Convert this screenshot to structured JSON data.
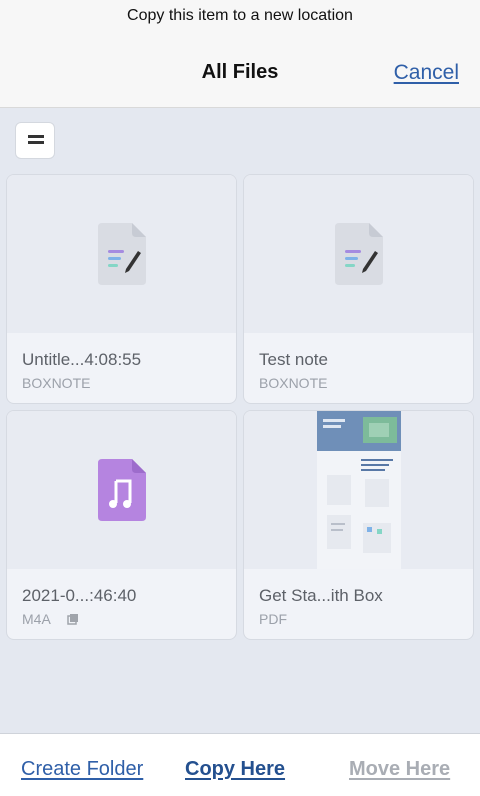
{
  "header": {
    "prompt": "Copy this item to a new location",
    "title": "All Files",
    "cancel_label": "Cancel"
  },
  "toolbar": {
    "view_toggle_icon": "list-view-icon"
  },
  "files": [
    {
      "name": "Untitle...4:08:55",
      "type": "BOXNOTE",
      "icon": "boxnote-icon"
    },
    {
      "name": "Test note",
      "type": "BOXNOTE",
      "icon": "boxnote-icon"
    },
    {
      "name": "2021-0...:46:40",
      "type": "M4A",
      "icon": "audio-file-icon",
      "badge": "offline-icon"
    },
    {
      "name": "Get Sta...ith Box",
      "type": "PDF",
      "icon": "pdf-thumbnail"
    }
  ],
  "footer": {
    "create_folder_label": "Create Folder",
    "copy_here_label": "Copy Here",
    "move_here_label": "Move Here"
  },
  "colors": {
    "link": "#2f5fa8",
    "background": "#e4e8f0",
    "disabled": "#a9adb4",
    "audio_icon": "#b584e0"
  }
}
